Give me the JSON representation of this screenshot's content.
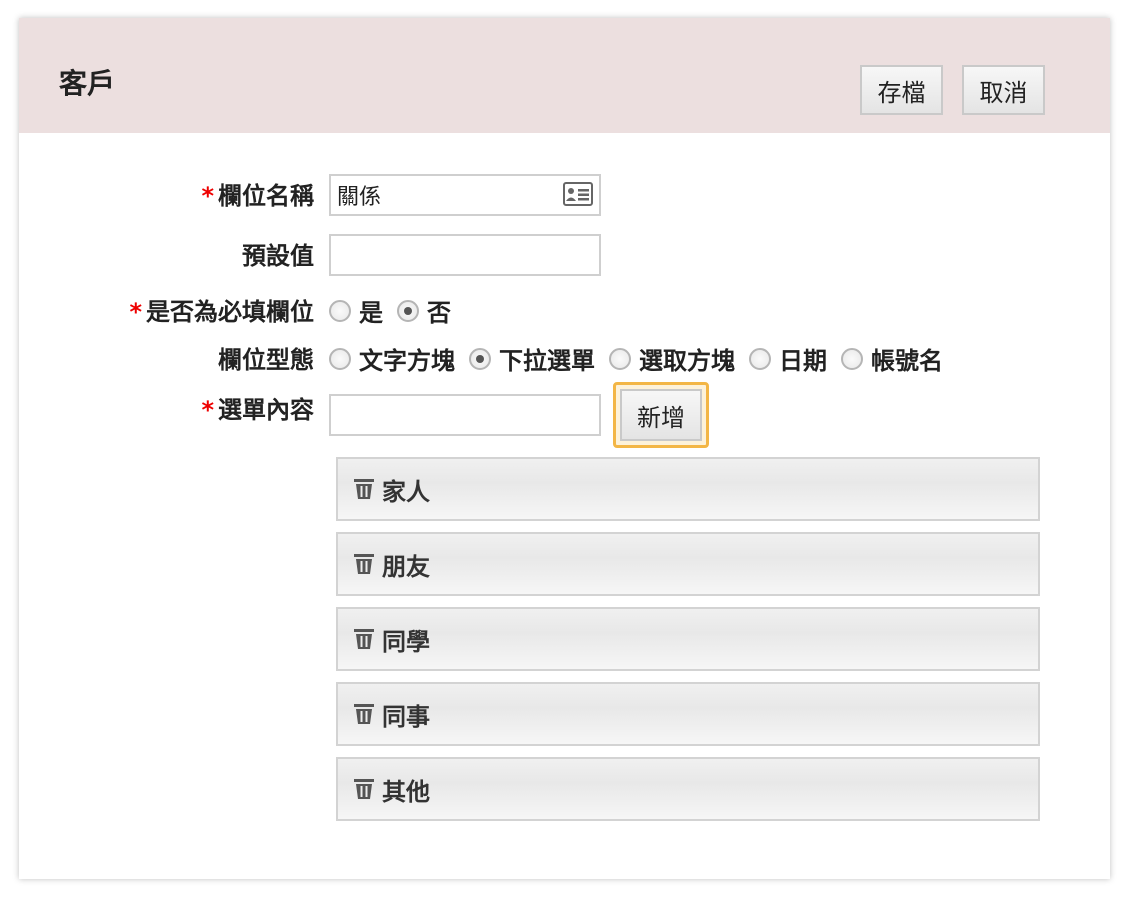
{
  "header": {
    "title": "客戶",
    "save_label": "存檔",
    "cancel_label": "取消"
  },
  "form": {
    "field_name_label": "欄位名稱",
    "field_name_value": "關係",
    "default_label": "預設值",
    "default_value": "",
    "required_label": "是否為必填欄位",
    "required_options": [
      "是",
      "否"
    ],
    "required_selected": "否",
    "type_label": "欄位型態",
    "type_options": [
      "文字方塊",
      "下拉選單",
      "選取方塊",
      "日期",
      "帳號名"
    ],
    "type_selected": "下拉選單",
    "menu_label": "選單內容",
    "menu_input_value": "",
    "add_label": "新增",
    "required_marker": "*"
  },
  "menu_items": [
    "家人",
    "朋友",
    "同學",
    "同事",
    "其他"
  ],
  "colors": {
    "header_bg": "#ecdfdf",
    "required_marker": "#e00000",
    "focus_ring": "#f3b646"
  }
}
